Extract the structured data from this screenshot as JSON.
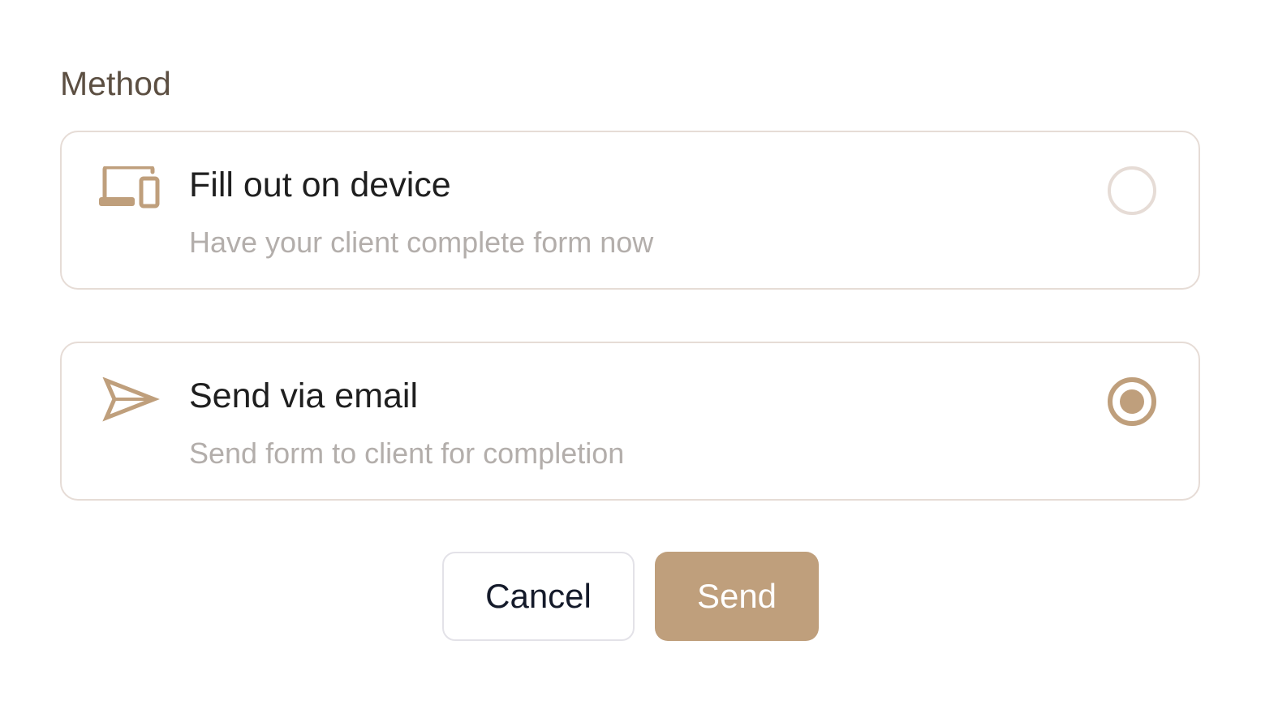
{
  "method": {
    "label": "Method",
    "options": [
      {
        "title": "Fill out on device",
        "description": "Have your client complete form now",
        "icon": "devices-icon",
        "selected": false
      },
      {
        "title": "Send via email",
        "description": "Send form to client for completion",
        "icon": "paper-plane-icon",
        "selected": true
      }
    ]
  },
  "actions": {
    "cancel_label": "Cancel",
    "send_label": "Send"
  },
  "colors": {
    "accent": "#bf9f7c",
    "border": "#e6dcd6",
    "label_text": "#5c4f42",
    "muted_text": "#b3aeab"
  }
}
